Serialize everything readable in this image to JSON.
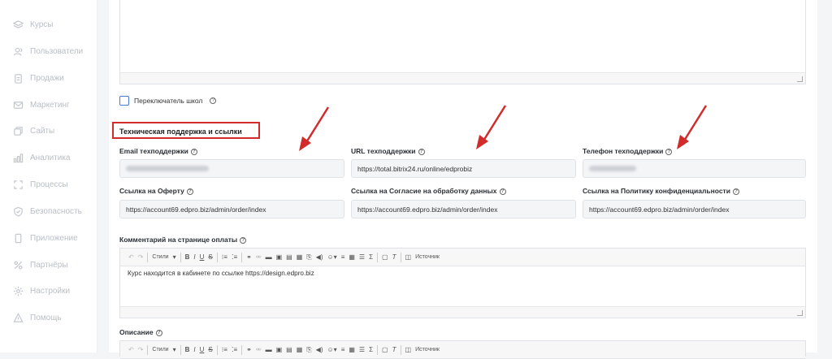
{
  "sidebar": {
    "items": [
      {
        "label": "Курсы",
        "icon": "layers-icon"
      },
      {
        "label": "Пользователи",
        "icon": "users-icon"
      },
      {
        "label": "Продажи",
        "icon": "clipboard-icon"
      },
      {
        "label": "Маркетинг",
        "icon": "mail-icon"
      },
      {
        "label": "Сайты",
        "icon": "pages-icon"
      },
      {
        "label": "Аналитика",
        "icon": "bar-chart-icon"
      },
      {
        "label": "Процессы",
        "icon": "process-icon"
      },
      {
        "label": "Безопасность",
        "icon": "shield-icon"
      },
      {
        "label": "Приложение",
        "icon": "phone-icon"
      },
      {
        "label": "Партнёры",
        "icon": "percent-icon"
      },
      {
        "label": "Настройки",
        "icon": "gear-icon"
      },
      {
        "label": "Помощь",
        "icon": "help-icon"
      }
    ]
  },
  "school_switch": {
    "label": "Переключатель школ"
  },
  "section": {
    "title": "Техническая поддержка и ссылки"
  },
  "fields": {
    "support_email": {
      "label": "Email техподдержки",
      "value": ""
    },
    "support_url": {
      "label": "URL техподдержки",
      "value": "https://total.bitrix24.ru/online/edprobiz"
    },
    "support_phone": {
      "label": "Телефон техподдержки",
      "value": ""
    },
    "offer_link": {
      "label": "Ссылка на Оферту",
      "value": "https://account69.edpro.biz/admin/order/index"
    },
    "consent_link": {
      "label": "Ссылка на Согласие на обработку данных",
      "value": "https://account69.edpro.biz/admin/order/index"
    },
    "privacy_link": {
      "label": "Ссылка на Политику конфиденциальности",
      "value": "https://account69.edpro.biz/admin/order/index"
    }
  },
  "payment_comment": {
    "label": "Комментарий на странице оплаты",
    "text": "Курс находится в кабинете по ссылке https://design.edpro.biz"
  },
  "description": {
    "label": "Описание"
  },
  "toolbar": {
    "styles": "Стили",
    "source": "Источник"
  },
  "colors": {
    "highlight": "#d12b2b",
    "accent": "#4b7bd6"
  }
}
